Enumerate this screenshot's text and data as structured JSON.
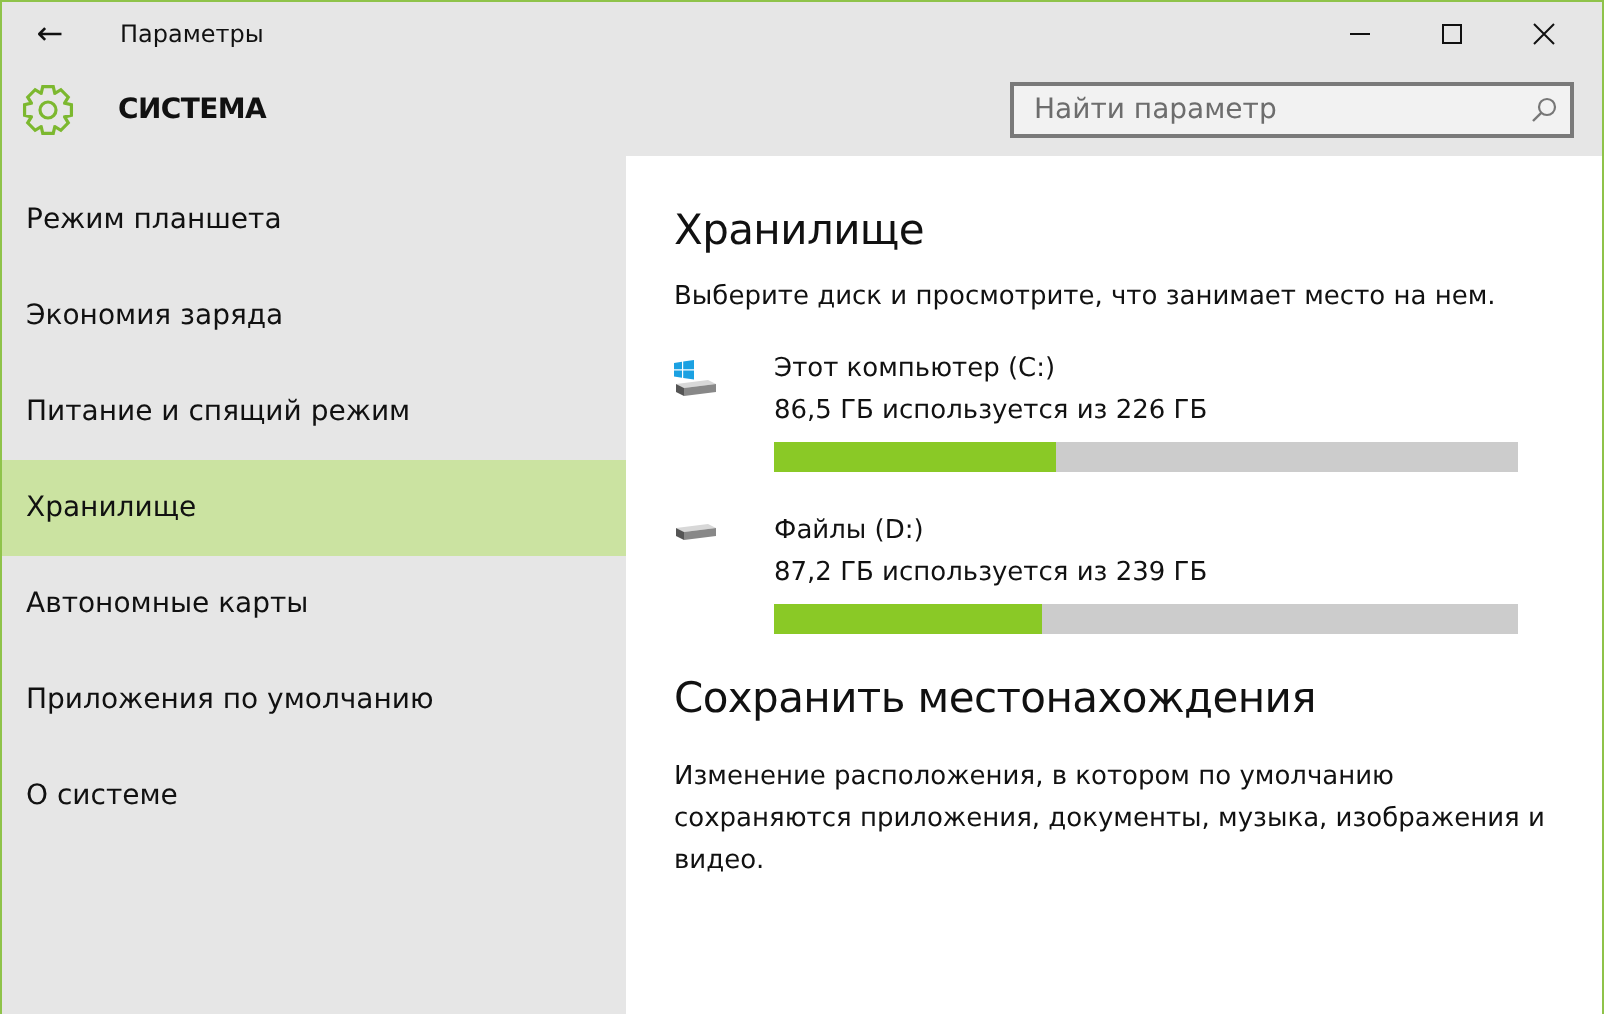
{
  "window": {
    "title": "Параметры",
    "back": "←"
  },
  "header": {
    "title": "СИСТЕМА",
    "search": {
      "placeholder": "Найти параметр"
    }
  },
  "sidebar": {
    "items": [
      {
        "label": "Режим планшета",
        "selected": false
      },
      {
        "label": "Экономия заряда",
        "selected": false
      },
      {
        "label": "Питание и спящий режим",
        "selected": false
      },
      {
        "label": "Хранилище",
        "selected": true
      },
      {
        "label": "Автономные карты",
        "selected": false
      },
      {
        "label": "Приложения по умолчанию",
        "selected": false
      },
      {
        "label": "О системе",
        "selected": false
      }
    ]
  },
  "storage": {
    "title": "Хранилище",
    "description": "Выберите диск и просмотрите, что занимает место на нем.",
    "drives": [
      {
        "kind": "system",
        "name": "Этот компьютер (C:)",
        "usage": "86,5 ГБ используется из 226 ГБ",
        "level": 0.38
      },
      {
        "kind": "data",
        "name": "Файлы (D:)",
        "usage": "87,2 ГБ используется из 239 ГБ",
        "level": 0.36
      }
    ]
  },
  "save_locations": {
    "title": "Сохранить местонахождения",
    "description": "Изменение расположения, в котором по умолчанию сохраняются приложения, документы, музыка, изображения и видео."
  }
}
